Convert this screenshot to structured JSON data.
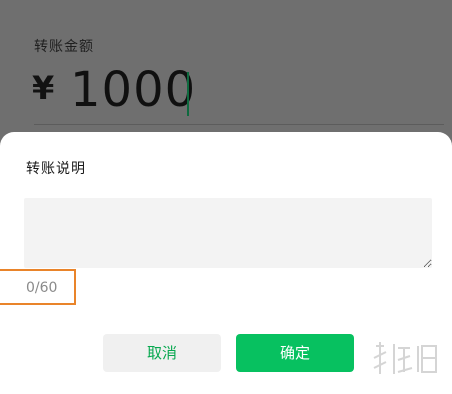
{
  "amount_section": {
    "label": "转账金额",
    "currency_symbol": "¥",
    "amount": "1000"
  },
  "note_sheet": {
    "title": "转账说明",
    "note_value": "",
    "char_count": "0/60",
    "cancel_label": "取消",
    "confirm_label": "确定"
  },
  "watermark": {
    "text": "游侠网"
  },
  "colors": {
    "overlay": "#6f6f6f",
    "sheet_bg": "#ffffff",
    "input_bg": "#f3f3f3",
    "confirm_bg": "#07c160",
    "cancel_text": "#07a84f",
    "highlight_border": "#e9842a",
    "caret": "#0e6a3f"
  }
}
